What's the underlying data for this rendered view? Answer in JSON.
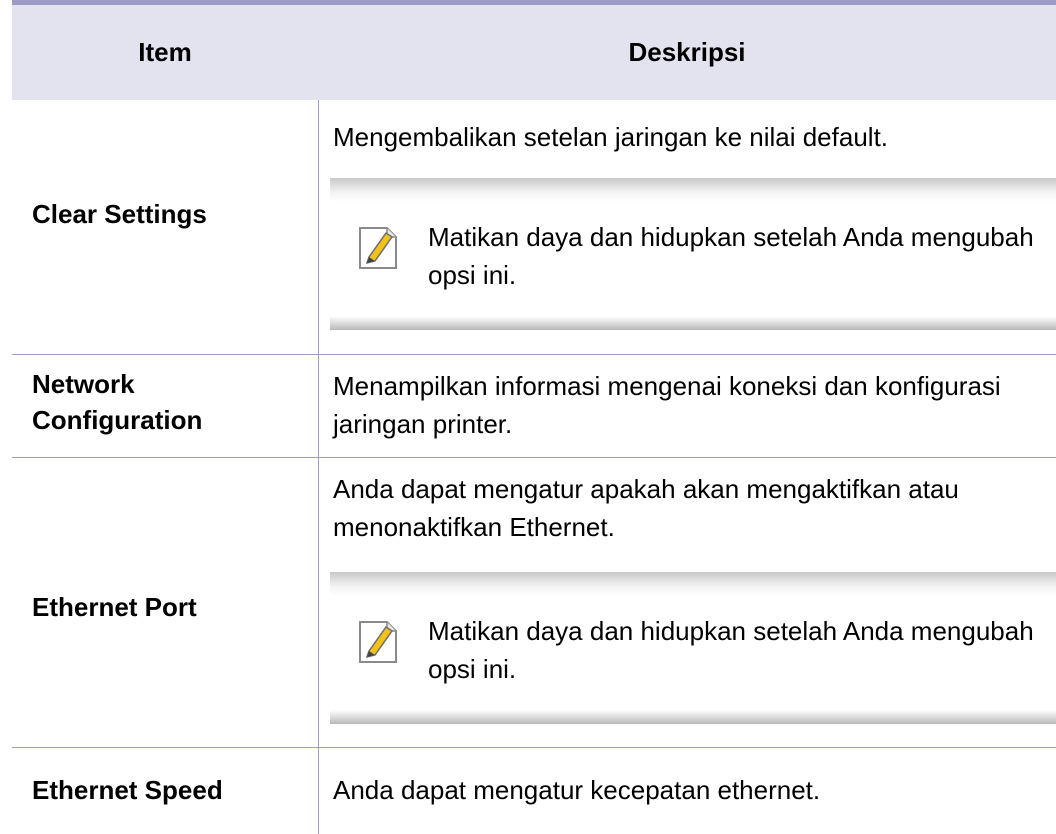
{
  "table": {
    "header": {
      "item": "Item",
      "description": "Deskripsi"
    },
    "rows": [
      {
        "item": "Clear Settings",
        "description": "Mengembalikan setelan jaringan ke nilai default.",
        "note": "Matikan daya dan hidupkan setelah Anda mengubah opsi ini."
      },
      {
        "item": "Network Configuration",
        "description": "Menampilkan informasi mengenai koneksi dan konfigurasi jaringan printer."
      },
      {
        "item": "Ethernet Port",
        "description": "Anda dapat mengatur apakah akan mengaktifkan atau menonaktifkan Ethernet.",
        "note": "Matikan daya dan hidupkan setelah Anda mengubah opsi ini."
      },
      {
        "item": "Ethernet Speed",
        "description": "Anda dapat mengatur kecepatan ethernet."
      }
    ]
  },
  "colors": {
    "rule": "#9e9ac8",
    "header_bg": "#e3e2ef",
    "note_band": "#c9c9c9",
    "pencil": "#f2c21b"
  },
  "icons": {
    "note": "note-pencil-icon"
  }
}
